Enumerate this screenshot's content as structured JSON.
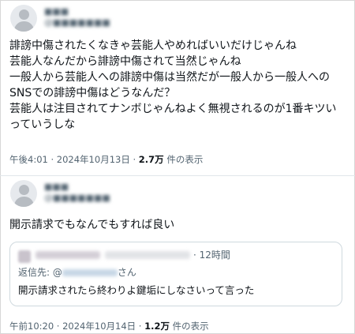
{
  "posts": [
    {
      "display_name": "■■■",
      "handle": "@■■■■■■■",
      "body": "誹謗中傷されたくなきゃ芸能人やめればいいだけじゃんね\n芸能人なんだから誹謗中傷されて当然じゃんね\n一般人から芸能人への誹謗中傷は当然だが一般人から一般人への\nSNSでの誹謗中傷はどうなんだ？\n芸能人は注目されてナンボじゃんねよく無視されるのが1番キツい\nっていうしな",
      "time": "午後4:01 · 2024年10月13日 · ",
      "views": "2.7万",
      "views_suffix": " 件の表示"
    },
    {
      "display_name": "■■■",
      "handle": "@■■■■■■■",
      "body": "開示請求でもなんでもすれば良い",
      "time": "午前10:20 · 2024年10月14日 · ",
      "views": "1.2万",
      "views_suffix": " 件の表示",
      "quote": {
        "time": "· 12時間",
        "reply_prefix": "返信先: @",
        "reply_suffix": "さん",
        "text": "開示請求されたら終わりよ鍵垢にしなさいって言った"
      }
    }
  ]
}
